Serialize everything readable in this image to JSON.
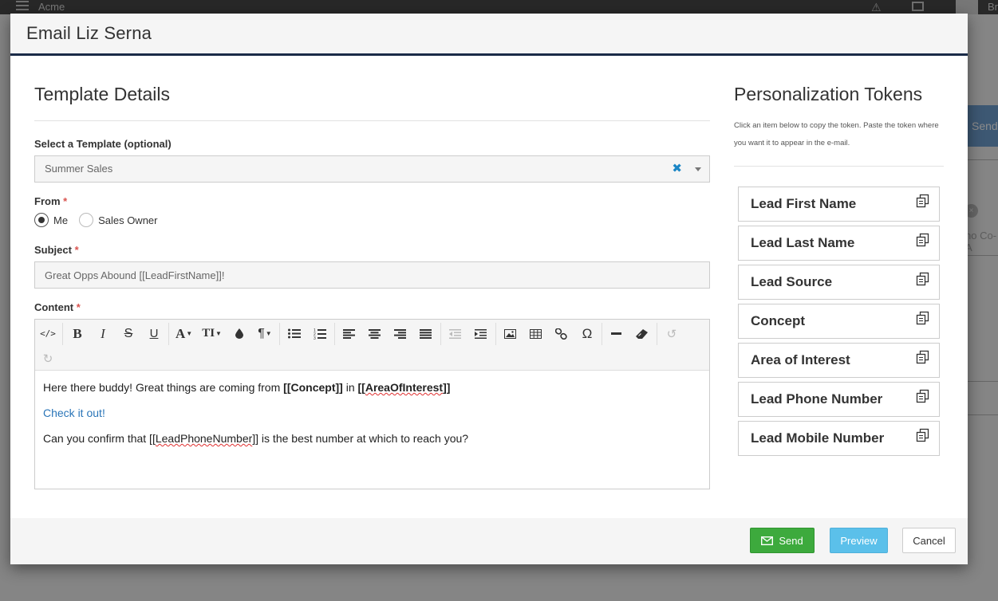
{
  "background": {
    "brand": "Acme",
    "user_initial": "Br",
    "send_label": "Send",
    "badge": "×",
    "row_text": "no Co-A"
  },
  "modal": {
    "title": "Email Liz Serna"
  },
  "template_details": {
    "heading": "Template Details",
    "template_label": "Select a Template (optional)",
    "template_value": "Summer Sales",
    "from_label": "From",
    "from_options": [
      "Me",
      "Sales Owner"
    ],
    "from_selected": "Me",
    "subject_label": "Subject",
    "subject_value": "Great Opps Abound [[LeadFirstName]]!",
    "content_label": "Content",
    "required_mark": "*"
  },
  "editor": {
    "content": {
      "line1_prefix": "Here there buddy! Great things are coming from ",
      "line1_token1": "[[Concept]]",
      "line1_mid": " in ",
      "line1_token2_open": "[[",
      "line1_token2_word": "AreaOfInterest",
      "line1_token2_close": "]]",
      "line2_link": "Check it out",
      "line2_suffix": "!",
      "line3_prefix": "Can you confirm that [[",
      "line3_word": "LeadPhoneNumber",
      "line3_suffix": "]] is the best number at which to reach you?"
    }
  },
  "tokens": {
    "heading": "Personalization Tokens",
    "hint": "Click an item below to copy the token. Paste the token where you want it to appear in the e-mail.",
    "items": [
      "Lead First Name",
      "Lead Last Name",
      "Lead Source",
      "Concept",
      "Area of Interest",
      "Lead Phone Number",
      "Lead Mobile Number"
    ]
  },
  "footer": {
    "send": "Send",
    "preview": "Preview",
    "cancel": "Cancel"
  },
  "colors": {
    "header_border": "#1a2b48",
    "send_button": "#3daa3d",
    "preview_button": "#5bc0ea",
    "link": "#2a75b8",
    "required": "#d9534f"
  }
}
